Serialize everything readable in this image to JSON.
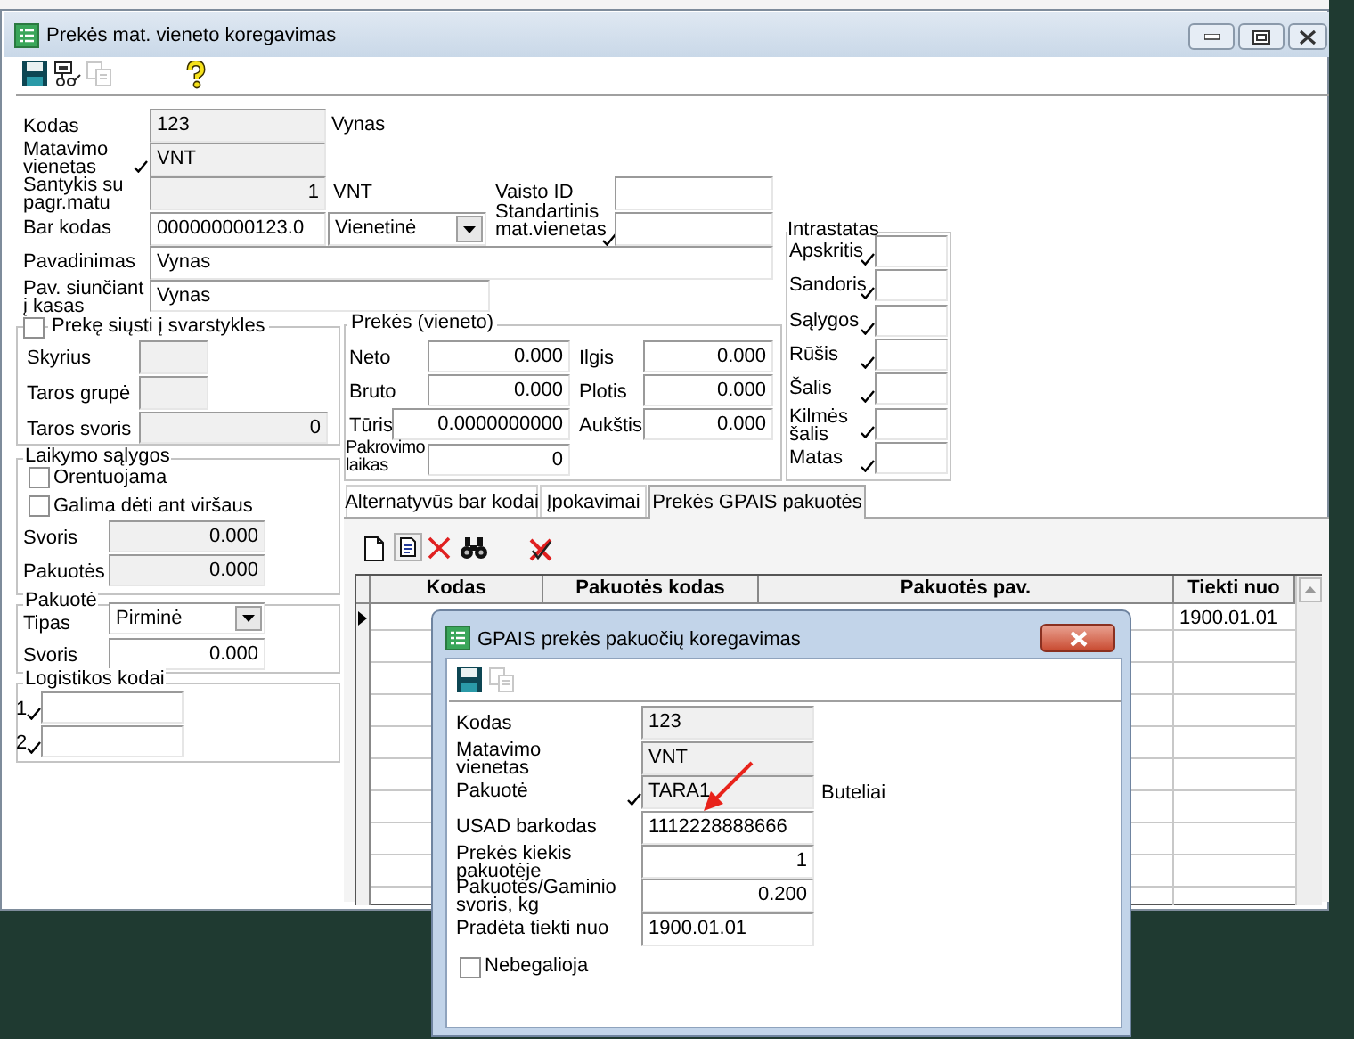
{
  "main_window": {
    "title": "Prekės mat. vieneto koregavimas",
    "toolbar": [
      {
        "kind": "save",
        "disabled": false
      },
      {
        "kind": "device",
        "disabled": false
      },
      {
        "kind": "copy",
        "disabled": true
      },
      {
        "kind": "help",
        "disabled": false
      }
    ],
    "form": {
      "code": {
        "label": "Kodas",
        "value": "123",
        "readonly": true,
        "description": "Vynas"
      },
      "unit": {
        "label": "Matavimo vienetas",
        "value": "VNT",
        "readonly": true,
        "lookup": true
      },
      "ratio": {
        "label": "Santykis su pagr.matu",
        "value": "1",
        "readonly": true,
        "numeric": true,
        "unit": "VNT"
      },
      "drug_id": {
        "label": "Vaisto ID",
        "readonly": false
      },
      "barcode": {
        "label": "Bar kodas",
        "value": "000000000123.0",
        "readonly": false,
        "type": "Vienetinė"
      },
      "standard_unit": {
        "label": "Standartinis mat.vienetas",
        "readonly": false,
        "lookup": true
      },
      "name": {
        "label": "Pavadinimas",
        "value": "Vynas",
        "readonly": false
      },
      "register_name": {
        "label": "Pav. siunčiant į kasas",
        "value": "Vynas",
        "readonly": false
      }
    },
    "scales": {
      "label": "Prekę siųsti į svarstykles",
      "checked": false,
      "fields": [
        {
          "label": "Skyrius",
          "readonly": true
        },
        {
          "label": "Taros grupė",
          "readonly": true
        },
        {
          "label": "Taros svoris",
          "value": "0",
          "readonly": true,
          "numeric": true
        }
      ]
    },
    "storage": {
      "title": "Laikymo sąlygos",
      "options": [
        {
          "label": "Orentuojama",
          "checked": false
        },
        {
          "label": "Galima dėti ant viršaus",
          "checked": false
        }
      ],
      "fields": [
        {
          "label": "Svoris",
          "value": "0.000",
          "readonly": true,
          "numeric": true
        },
        {
          "label": "Pakuotės",
          "value": "0.000",
          "readonly": true,
          "numeric": true
        }
      ]
    },
    "package": {
      "title": "Pakuotė",
      "type": {
        "label": "Tipas",
        "value": "Pirminė"
      },
      "weight": {
        "label": "Svoris",
        "value": "0.000",
        "readonly": false,
        "numeric": true
      }
    },
    "logistics": {
      "title": "Logistikos kodai",
      "codes": [
        {
          "label": "1",
          "lookup": true,
          "readonly": false
        },
        {
          "label": "2",
          "lookup": true,
          "readonly": false
        }
      ]
    },
    "unit_params": {
      "title": "Prekės (vieneto)",
      "left": [
        {
          "label": "Neto",
          "value": "0.000",
          "readonly": false,
          "numeric": true
        },
        {
          "label": "Bruto",
          "value": "0.000",
          "readonly": false,
          "numeric": true
        },
        {
          "label": "Tūris",
          "value": "0.0000000000",
          "readonly": false,
          "numeric": true
        },
        {
          "label": "Pakrovimo laikas",
          "value": "0",
          "readonly": false,
          "numeric": true
        }
      ],
      "right": [
        {
          "label": "Ilgis",
          "value": "0.000",
          "readonly": false,
          "numeric": true
        },
        {
          "label": "Plotis",
          "value": "0.000",
          "readonly": false,
          "numeric": true
        },
        {
          "label": "Aukštis",
          "value": "0.000",
          "readonly": false,
          "numeric": true
        }
      ]
    },
    "intrastat": {
      "title": "Intrastatas",
      "fields": [
        {
          "label": "Apskritis",
          "lookup": true,
          "readonly": false
        },
        {
          "label": "Sandoris",
          "lookup": true,
          "readonly": false
        },
        {
          "label": "Sąlygos",
          "lookup": true,
          "readonly": false
        },
        {
          "label": "Rūšis",
          "lookup": true,
          "readonly": false
        },
        {
          "label": "Šalis",
          "lookup": true,
          "readonly": false
        },
        {
          "label": "Kilmės šalis",
          "lookup": true,
          "readonly": false
        },
        {
          "label": "Matas",
          "lookup": true,
          "readonly": false
        }
      ]
    },
    "tabs": [
      {
        "label": "Alternatyvūs bar kodai",
        "selected": false
      },
      {
        "label": "Įpokavimai",
        "selected": false
      },
      {
        "label": "Prekės GPAIS pakuotės",
        "selected": true
      }
    ],
    "grid_toolbar": [
      {
        "kind": "new"
      },
      {
        "kind": "edit"
      },
      {
        "kind": "delete"
      },
      {
        "kind": "find"
      },
      {
        "kind": "cancel"
      }
    ],
    "table": {
      "columns": [
        "Kodas",
        "Pakuotės kodas",
        "Pakuotės pav.",
        "Tiekti nuo"
      ],
      "rows": [
        {
          "selected": true,
          "tiekti_nuo": "1900.01.01"
        }
      ]
    }
  },
  "dialog": {
    "title": "GPAIS prekės pakuočių koregavimas",
    "toolbar": [
      {
        "kind": "save",
        "disabled": false
      },
      {
        "kind": "copy",
        "disabled": true
      }
    ],
    "fields": [
      {
        "label": "Kodas",
        "value": "123",
        "readonly": true
      },
      {
        "label": "Matavimo vienetas",
        "value": "VNT",
        "readonly": true
      },
      {
        "label": "Pakuotė",
        "value": "TARA1",
        "readonly": true,
        "lookup": true,
        "description": "Buteliai"
      },
      {
        "label": "USAD barkodas",
        "value": "1112228888666",
        "readonly": false
      },
      {
        "label": "Prekės kiekis pakuotėje",
        "value": "1",
        "readonly": false,
        "numeric": true
      },
      {
        "label": "Pakuotės/Gaminio svoris, kg",
        "value": "0.200",
        "readonly": false,
        "numeric": true
      },
      {
        "label": "Pradėta tiekti nuo",
        "value": "1900.01.01",
        "readonly": false
      }
    ],
    "invalid": {
      "label": "Nebegalioja",
      "checked": false
    }
  }
}
